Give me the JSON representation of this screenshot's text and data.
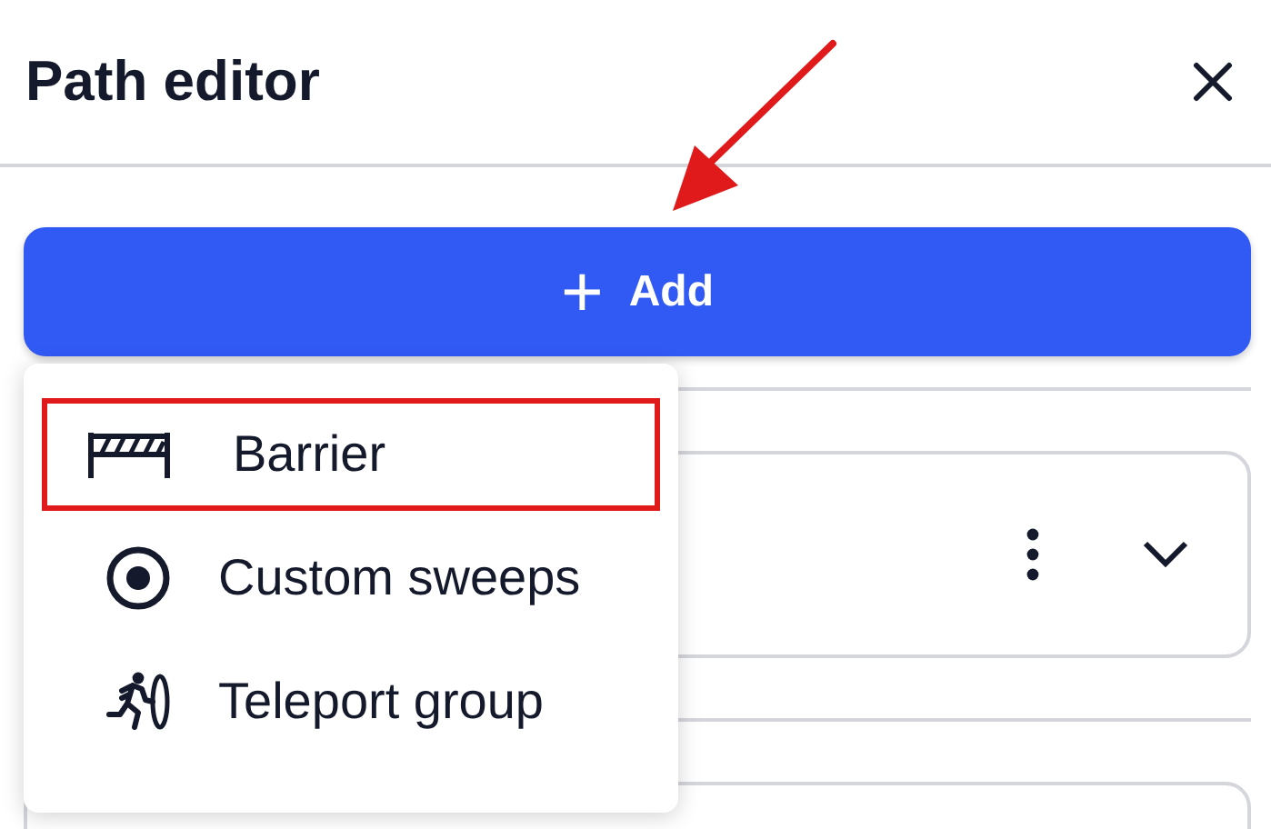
{
  "panel": {
    "title": "Path editor"
  },
  "add_button": {
    "icon": "+",
    "label": "Add"
  },
  "cards": [
    {
      "kind": "collapsed",
      "expanded": false
    },
    {
      "kind": "partial"
    }
  ],
  "menu": {
    "items": [
      {
        "kind": "barrier",
        "label": "Barrier",
        "highlighted": true
      },
      {
        "kind": "sweeps",
        "label": "Custom sweeps",
        "highlighted": false
      },
      {
        "kind": "teleport",
        "label": "Teleport group",
        "highlighted": false
      }
    ]
  },
  "annotations": [
    {
      "kind": "arrow",
      "color": "#e0191b"
    }
  ]
}
